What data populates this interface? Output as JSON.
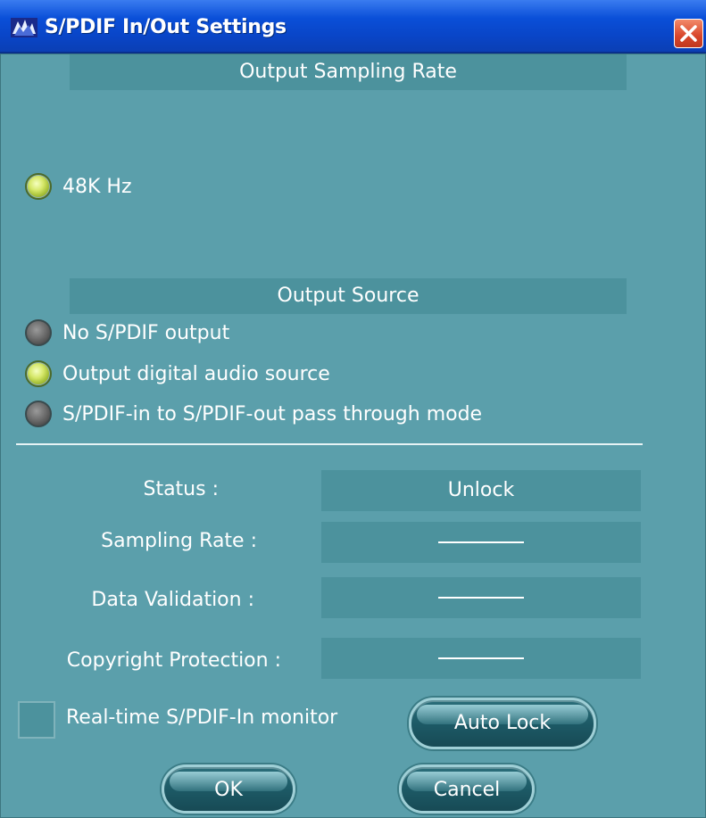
{
  "window": {
    "title": "S/PDIF In/Out Settings",
    "icon": "app-logo-icon",
    "close_icon": "close-icon"
  },
  "sampling_rate_section": {
    "header": "Output Sampling Rate",
    "options": [
      {
        "label": "48K Hz",
        "selected": true
      }
    ]
  },
  "output_source_section": {
    "header": "Output Source",
    "options": [
      {
        "label": "No S/PDIF output",
        "selected": false
      },
      {
        "label": "Output digital audio source",
        "selected": true
      },
      {
        "label": "S/PDIF-in to S/PDIF-out pass through mode",
        "selected": false
      }
    ]
  },
  "status_section": {
    "rows": [
      {
        "label": "Status :",
        "value": "Unlock"
      },
      {
        "label": "Sampling Rate :",
        "value": ""
      },
      {
        "label": "Data Validation :",
        "value": ""
      },
      {
        "label": "Copyright Protection :",
        "value": ""
      }
    ]
  },
  "monitor": {
    "label": "Real-time S/PDIF-In monitor",
    "checked": false
  },
  "buttons": {
    "auto_lock": "Auto Lock",
    "ok": "OK",
    "cancel": "Cancel"
  },
  "colors": {
    "background": "#5b9fab",
    "panel": "#4c929d",
    "title_bar": "#0a4fd8",
    "radio_on": "#d6e86a",
    "radio_off": "#6e6e6e",
    "close_button": "#d8452a"
  }
}
